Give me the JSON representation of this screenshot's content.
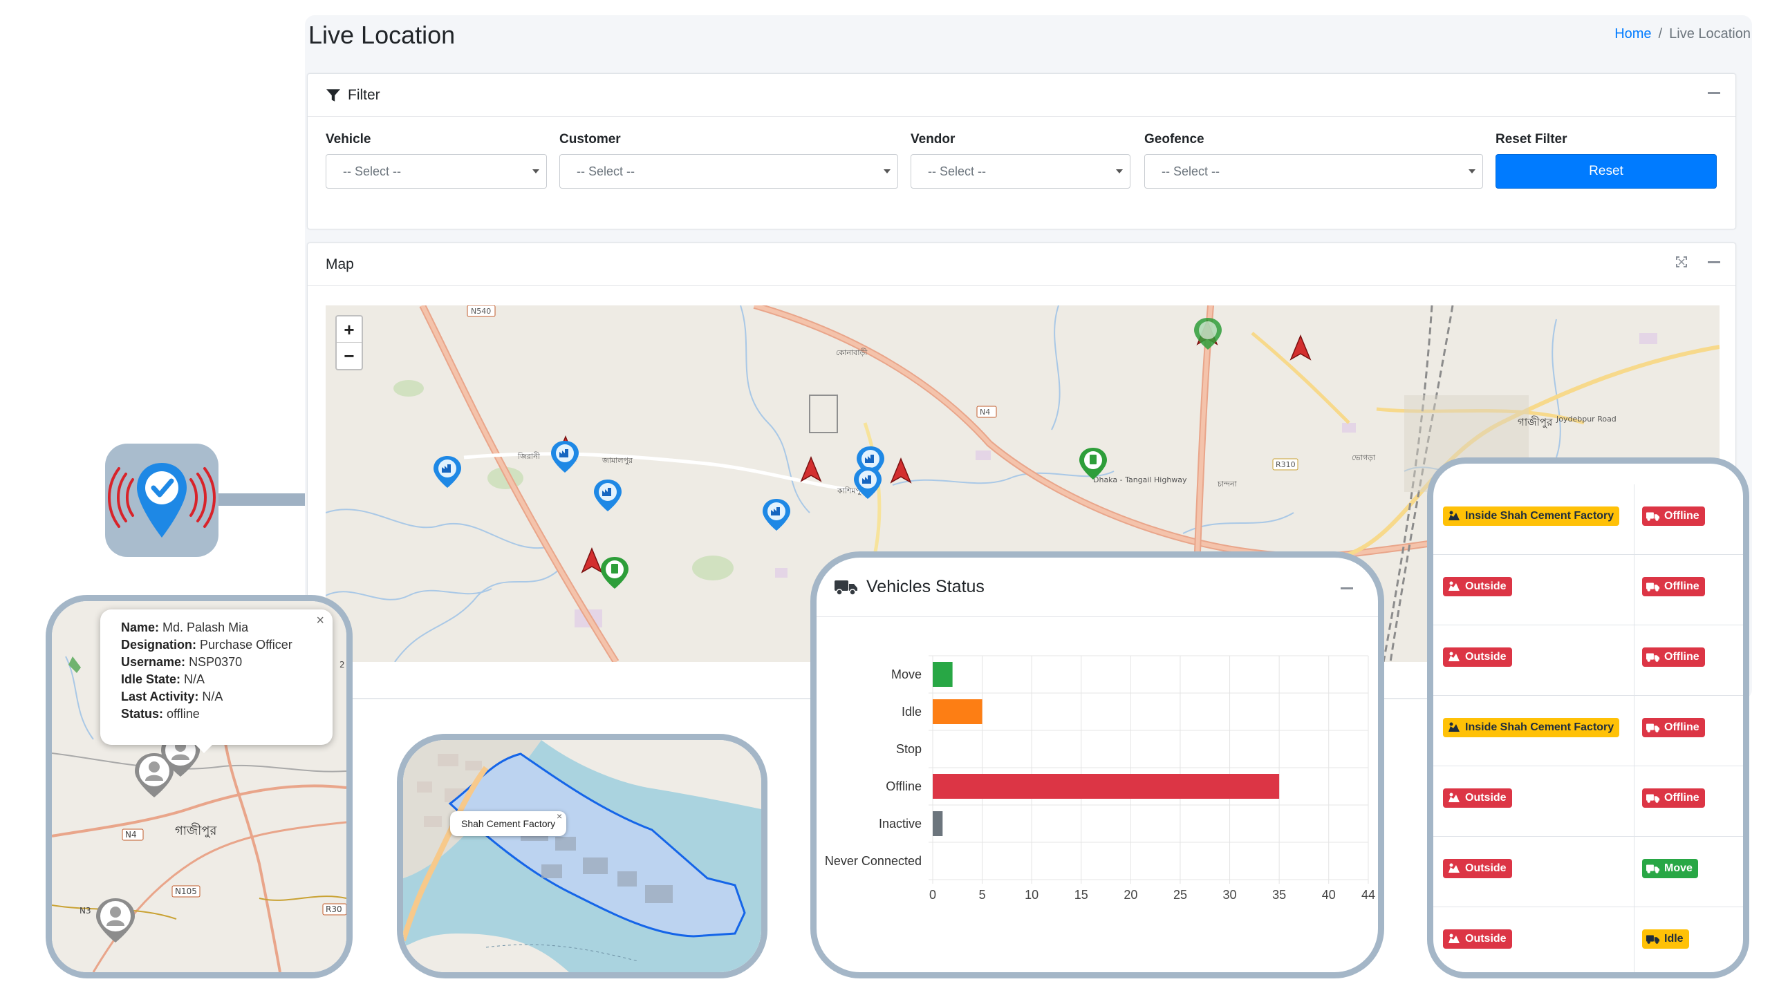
{
  "page": {
    "title": "Live Location",
    "breadcrumb": {
      "home": "Home",
      "separator": "/",
      "current": "Live Location"
    }
  },
  "filter": {
    "title": "Filter",
    "fields": [
      {
        "label": "Vehicle",
        "placeholder": "-- Select --"
      },
      {
        "label": "Customer",
        "placeholder": "-- Select --"
      },
      {
        "label": "Vendor",
        "placeholder": "-- Select --"
      },
      {
        "label": "Geofence",
        "placeholder": "-- Select --"
      }
    ],
    "reset_label": "Reset Filter",
    "reset_button": "Reset"
  },
  "map": {
    "title": "Map",
    "zoom_in": "+",
    "zoom_out": "−",
    "place_labels": {
      "n540": "N540",
      "kashimpur": "কাশিমপুর",
      "n4": "N4",
      "gazipur": "গাজীপুর",
      "r310": "R310",
      "joydebpur": "Joydebpur Road",
      "dhaka_tangail": "Dhaka - Tangail Highway",
      "chandra": "চান্দনা",
      "konabari": "কোনাবাড়ী",
      "zirani": "জিরানী",
      "jamalpur": "জামালপুর",
      "bhogra": "ভোগড়া"
    }
  },
  "user_popup": {
    "close": "×",
    "rows": [
      {
        "key": "Name:",
        "value": "Md. Palash Mia"
      },
      {
        "key": "Designation:",
        "value": "Purchase Officer"
      },
      {
        "key": "Username:",
        "value": "NSP0370"
      },
      {
        "key": "Idle State:",
        "value": "N/A"
      },
      {
        "key": "Last Activity:",
        "value": "N/A"
      },
      {
        "key": "Status:",
        "value": "offline"
      }
    ],
    "map_labels": {
      "n4": "N4",
      "gazipur": "গাজীপুর",
      "n105": "N105",
      "r30": "R30",
      "n3": "N3",
      "edge": "2"
    }
  },
  "geofence_popup": {
    "name": "Shah Cement Factory",
    "close": "×"
  },
  "vehicles_status": {
    "title": "Vehicles Status",
    "chart_data": {
      "type": "bar",
      "orientation": "horizontal",
      "categories": [
        "Move",
        "Idle",
        "Stop",
        "Offline",
        "Inactive",
        "Never Connected"
      ],
      "values": [
        2,
        5,
        0,
        35,
        1,
        0
      ],
      "colors": [
        "#28a745",
        "#fd7e14",
        "#dc3545",
        "#dc3545",
        "#6c757d",
        "#17a2b8"
      ],
      "xlim": [
        0,
        44
      ],
      "xticks": [
        "0",
        "5",
        "10",
        "15",
        "20",
        "25",
        "30",
        "35",
        "40",
        "44"
      ],
      "grid": true
    }
  },
  "geofence_status": {
    "rows": [
      {
        "zone": "Inside Shah Cement Factory",
        "zone_type": "warning",
        "state": "Offline",
        "state_type": "danger"
      },
      {
        "zone": "Outside",
        "zone_type": "danger",
        "state": "Offline",
        "state_type": "danger"
      },
      {
        "zone": "Outside",
        "zone_type": "danger",
        "state": "Offline",
        "state_type": "danger"
      },
      {
        "zone": "Inside Shah Cement Factory",
        "zone_type": "warning",
        "state": "Offline",
        "state_type": "danger"
      },
      {
        "zone": "Outside",
        "zone_type": "danger",
        "state": "Offline",
        "state_type": "danger"
      },
      {
        "zone": "Outside",
        "zone_type": "danger",
        "state": "Move",
        "state_type": "success"
      },
      {
        "zone": "Outside",
        "zone_type": "danger",
        "state": "Idle",
        "state_type": "warning"
      }
    ]
  },
  "colors": {
    "primary": "#007bff",
    "danger": "#dc3545",
    "warning": "#ffc107",
    "success": "#28a745",
    "frame": "#a4b6c7"
  },
  "icons": [
    "filter-icon",
    "truck-icon",
    "location-check-icon",
    "factory-marker-icon",
    "fuel-marker-icon",
    "vehicle-arrow-icon",
    "user-marker-icon",
    "zone-icon"
  ]
}
